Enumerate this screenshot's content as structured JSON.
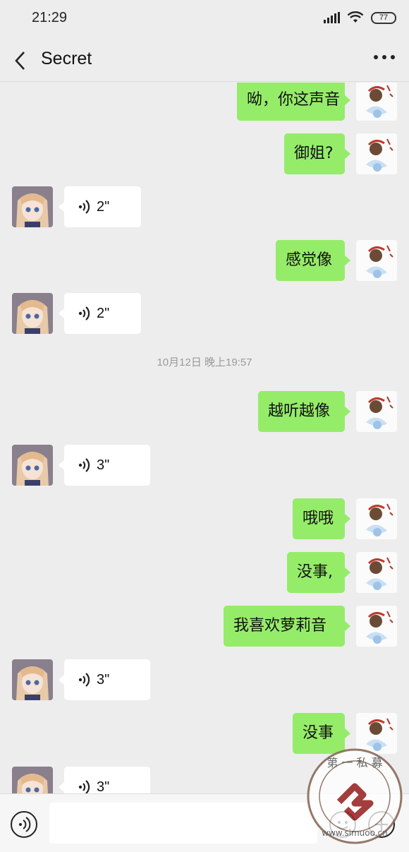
{
  "status_bar": {
    "time": "21:29",
    "battery": "77"
  },
  "header": {
    "title": "Secret",
    "back_icon": "chevron-left-icon",
    "more_icon": "more-dots-icon"
  },
  "messages": [
    {
      "from": "me",
      "text": "呦，你这声音"
    },
    {
      "from": "me",
      "text": "御姐?"
    },
    {
      "from": "other",
      "type": "voice",
      "duration": "2\""
    },
    {
      "from": "me",
      "text": "感觉像"
    },
    {
      "from": "other",
      "type": "voice",
      "duration": "2\""
    },
    {
      "type": "timestamp",
      "text": "10月12日 晚上19:57"
    },
    {
      "from": "me",
      "text": "越听越像"
    },
    {
      "from": "other",
      "type": "voice",
      "duration": "3\""
    },
    {
      "from": "me",
      "text": "哦哦"
    },
    {
      "from": "me",
      "text": "没事,"
    },
    {
      "from": "me",
      "text": "我喜欢萝莉音"
    },
    {
      "from": "other",
      "type": "voice",
      "duration": "3\""
    },
    {
      "from": "me",
      "text": "没事"
    },
    {
      "from": "other",
      "type": "voice",
      "duration": "3\""
    }
  ],
  "input_bar": {
    "placeholder": "",
    "voice_icon": "voice-mode-icon",
    "emoji_icon": "emoji-icon",
    "plus_icon": "plus-icon"
  },
  "watermark": {
    "top_text": "第 一 私 募",
    "bottom_text": "www.simuoo.cn"
  },
  "colors": {
    "background": "#ededed",
    "outgoing_bubble": "#95ec69",
    "incoming_bubble": "#ffffff",
    "timestamp": "#9a9a9a"
  }
}
